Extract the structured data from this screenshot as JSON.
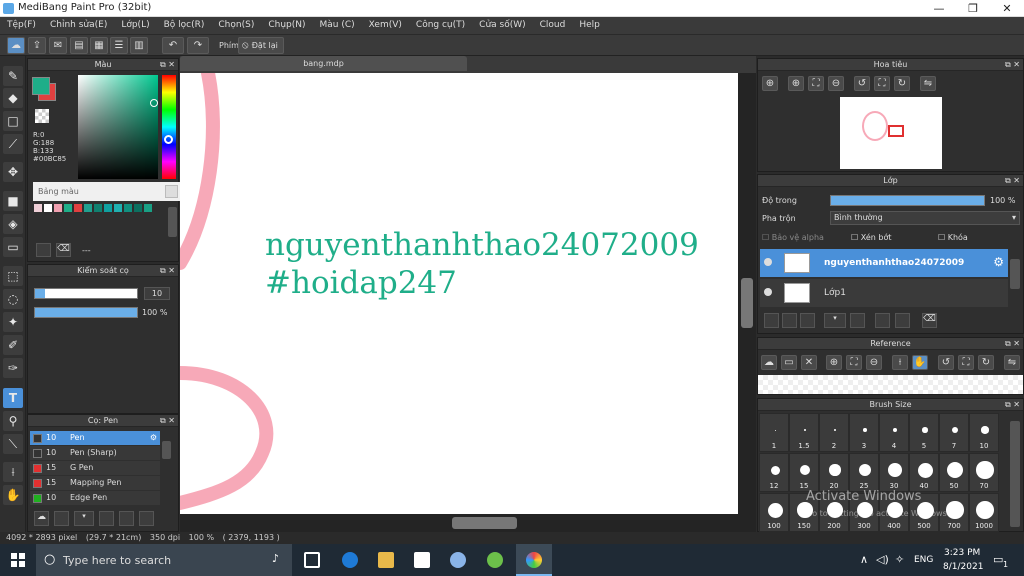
{
  "window": {
    "title": "MediBang Paint Pro (32bit)",
    "minimize": "—",
    "maximize": "❐",
    "close": "✕"
  },
  "menu": [
    "Tệp(F)",
    "Chỉnh sửa(E)",
    "Lớp(L)",
    "Bộ lọc(R)",
    "Chọn(S)",
    "Chụp(N)",
    "Màu (C)",
    "Xem(V)",
    "Công cụ(T)",
    "Cửa số(W)",
    "Cloud",
    "Help"
  ],
  "toolbar": {
    "phim_label": "Phím",
    "reset_label": "Đặt lại"
  },
  "document": {
    "tab": "bang.mdp",
    "line1": "nguyenthanhthao24072009",
    "line2": "#hoidap247"
  },
  "color_panel": {
    "title": "Màu",
    "r": "R:0",
    "g": "G:188",
    "b": "B:133",
    "hex": "#00BC85",
    "palette_title": "Bảng màu",
    "palette_name": "---",
    "palette_swatches": [
      "#f0d0d8",
      "#ffffff",
      "#f0a0b0",
      "#1fae89",
      "#e04040",
      "#20a090",
      "#108070",
      "#10a0a0",
      "#20b0b0",
      "#109080",
      "#0c7060",
      "#1aa085"
    ]
  },
  "control_panel": {
    "title": "Kiểm soát cọ",
    "size": "10",
    "opacity": "100 %",
    "size_fill": 0.1,
    "opacity_fill": 1.0
  },
  "brush_panel": {
    "title": "Cọ: Pen",
    "items": [
      {
        "size": "10",
        "name": "Pen",
        "color": "#333333",
        "selected": true
      },
      {
        "size": "10",
        "name": "Pen (Sharp)",
        "color": "#333333",
        "selected": false
      },
      {
        "size": "15",
        "name": "G Pen",
        "color": "#e23030",
        "selected": false
      },
      {
        "size": "15",
        "name": "Mapping Pen",
        "color": "#e23030",
        "selected": false
      },
      {
        "size": "10",
        "name": "Edge Pen",
        "color": "#20b020",
        "selected": false
      }
    ]
  },
  "navigator": {
    "title": "Hoa tiêu"
  },
  "layer_panel": {
    "title": "Lớp",
    "opacity_label": "Độ trong",
    "opacity_value": "100 %",
    "opacity_fill": 1.0,
    "blend_label": "Pha trộn",
    "blend_value": "Bình thường",
    "protect_alpha": "Bảo vệ alpha",
    "clipping": "Xén bớt",
    "lock": "Khóa",
    "layers": [
      {
        "name": "nguyenthanhthao24072009",
        "selected": true
      },
      {
        "name": "Lớp1",
        "selected": false
      }
    ]
  },
  "reference_panel": {
    "title": "Reference"
  },
  "brush_size_panel": {
    "title": "Brush Size",
    "sizes": [
      "1",
      "1.5",
      "2",
      "3",
      "4",
      "5",
      "7",
      "10",
      "12",
      "15",
      "20",
      "25",
      "30",
      "40",
      "50",
      "70",
      "100",
      "150",
      "200",
      "300",
      "400",
      "500",
      "700",
      "1000"
    ],
    "watermark1": "Activate Windows",
    "watermark2": "Go to Settings to activate Windows."
  },
  "status": {
    "dims": "4092 * 2893 pixel",
    "cm": "(29.7 * 21cm)",
    "dpi": "350 dpi",
    "zoom": "100 %",
    "coords": "( 2379, 1193 )"
  },
  "taskbar": {
    "search_placeholder": "Type here to search",
    "lang": "ENG",
    "time": "3:23 PM",
    "date": "8/1/2021",
    "notify": "1"
  }
}
